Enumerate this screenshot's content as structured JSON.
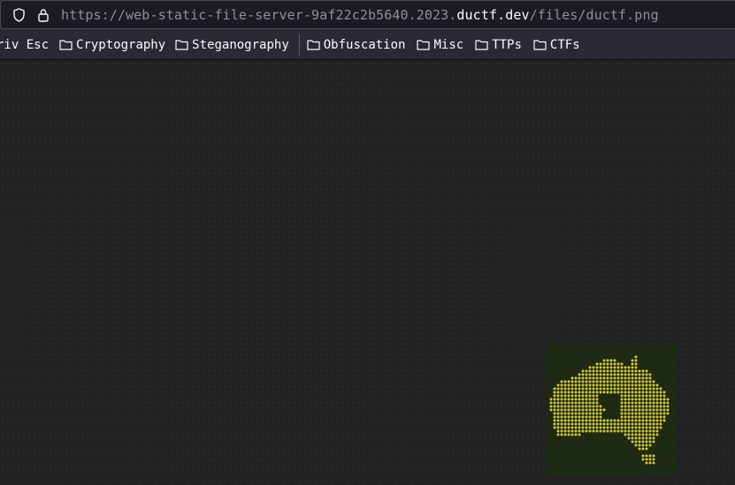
{
  "urlbar": {
    "url_prefix": "https://web-static-file-server-9af22c2b5640.2023.",
    "url_domain": "ductf.dev",
    "url_path": "/files/ductf.png"
  },
  "bookmarks": {
    "items": [
      {
        "label": "riv Esc",
        "folder": false
      },
      {
        "label": "Cryptography",
        "folder": true
      },
      {
        "label": "Steganography",
        "folder": true
      },
      {
        "label": "Obfuscation",
        "folder": true
      },
      {
        "label": "Misc",
        "folder": true
      },
      {
        "label": "TTPs",
        "folder": true
      },
      {
        "label": "CTFs",
        "folder": true
      }
    ]
  },
  "image": {
    "icon": "australia-map-logo",
    "dot_color": "#d6c93a",
    "background_color": "#1e2a14"
  }
}
